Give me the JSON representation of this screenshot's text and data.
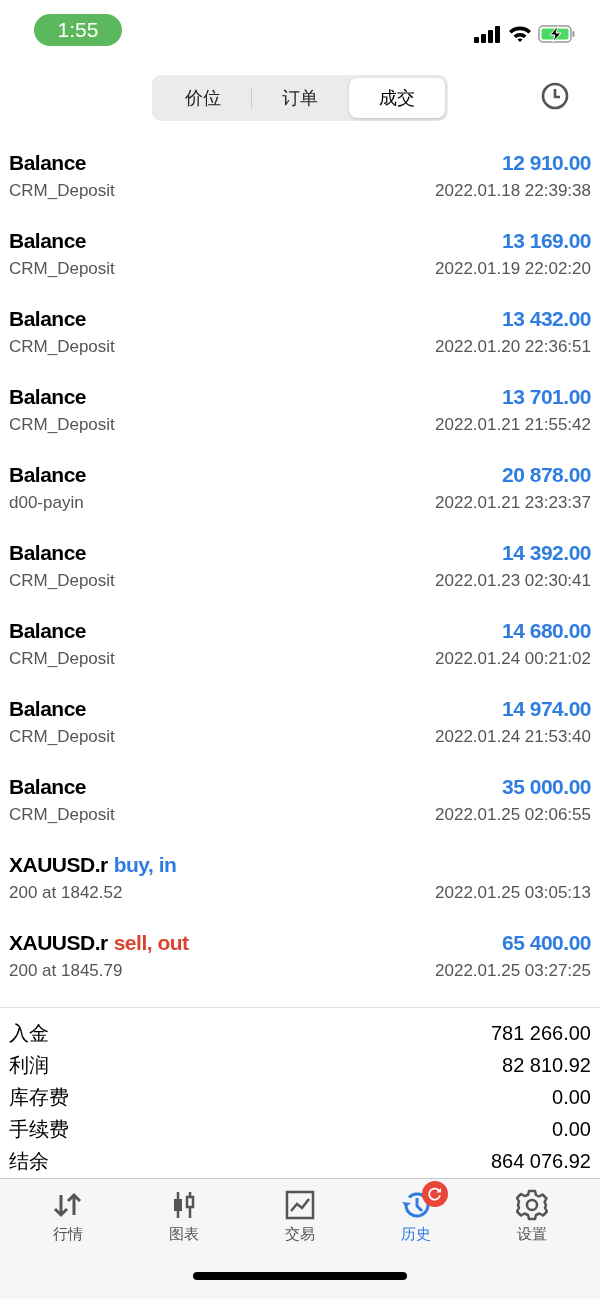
{
  "status_bar": {
    "time": "1:55"
  },
  "segments": [
    {
      "label": "价位",
      "selected": false
    },
    {
      "label": "订单",
      "selected": false
    },
    {
      "label": "成交",
      "selected": true
    }
  ],
  "deals": [
    {
      "title": "Balance",
      "amount": "12 910.00",
      "comment": "CRM_Deposit",
      "time": "2022.01.18 22:39:38"
    },
    {
      "title": "Balance",
      "amount": "13 169.00",
      "comment": "CRM_Deposit",
      "time": "2022.01.19 22:02:20"
    },
    {
      "title": "Balance",
      "amount": "13 432.00",
      "comment": "CRM_Deposit",
      "time": "2022.01.20 22:36:51"
    },
    {
      "title": "Balance",
      "amount": "13 701.00",
      "comment": "CRM_Deposit",
      "time": "2022.01.21 21:55:42"
    },
    {
      "title": "Balance",
      "amount": "20 878.00",
      "comment": "d00-payin",
      "time": "2022.01.21 23:23:37"
    },
    {
      "title": "Balance",
      "amount": "14 392.00",
      "comment": "CRM_Deposit",
      "time": "2022.01.23 02:30:41"
    },
    {
      "title": "Balance",
      "amount": "14 680.00",
      "comment": "CRM_Deposit",
      "time": "2022.01.24 00:21:02"
    },
    {
      "title": "Balance",
      "amount": "14 974.00",
      "comment": "CRM_Deposit",
      "time": "2022.01.24 21:53:40"
    },
    {
      "title": "Balance",
      "amount": "35 000.00",
      "comment": "CRM_Deposit",
      "time": "2022.01.25 02:06:55"
    },
    {
      "title": "XAUUSD.r",
      "action": {
        "text": "buy, in",
        "kind": "buy"
      },
      "comment": "200 at 1842.52",
      "time": "2022.01.25 03:05:13"
    },
    {
      "title": "XAUUSD.r",
      "action": {
        "text": "sell, out",
        "kind": "sell"
      },
      "amount": "65 400.00",
      "comment": "200 at 1845.79",
      "time": "2022.01.25 03:27:25"
    }
  ],
  "summary": [
    {
      "label": "入金",
      "value": "781 266.00"
    },
    {
      "label": "利润",
      "value": "82 810.92"
    },
    {
      "label": "库存费",
      "value": "0.00"
    },
    {
      "label": "手续费",
      "value": "0.00"
    },
    {
      "label": "结余",
      "value": "864 076.92"
    }
  ],
  "tab_bar": [
    {
      "label": "行情",
      "selected": false
    },
    {
      "label": "图表",
      "selected": false
    },
    {
      "label": "交易",
      "selected": false
    },
    {
      "label": "历史",
      "selected": true,
      "badge": true
    },
    {
      "label": "设置",
      "selected": false
    }
  ]
}
